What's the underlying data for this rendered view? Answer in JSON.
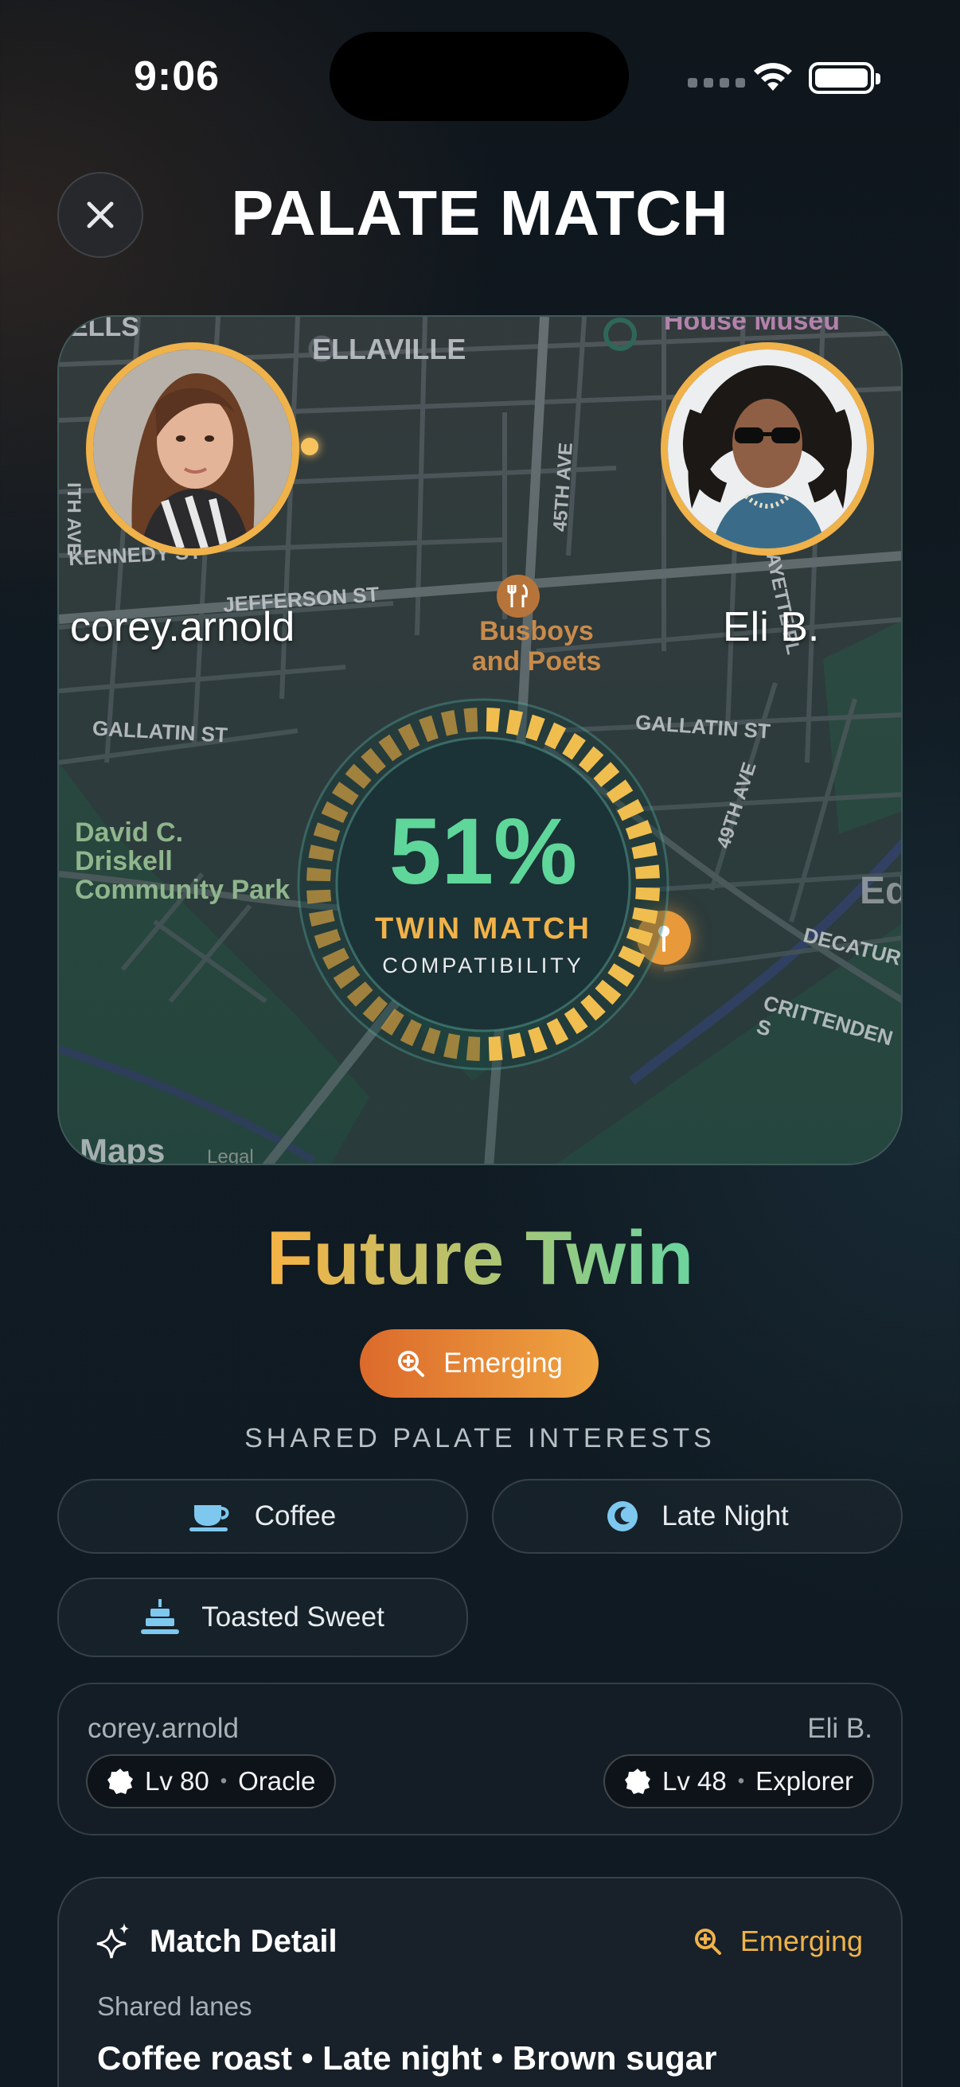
{
  "status_bar": {
    "time": "9:06"
  },
  "header": {
    "title": "PALATE MATCH"
  },
  "map": {
    "labels": {
      "ellaville": "ELLAVILLE",
      "ells": "ELLS",
      "house_museum": "House Museu",
      "kennedy": "KENNEDY ST",
      "jefferson": "JEFFERSON ST",
      "gallatin_left": "GALLATIN ST",
      "gallatin_right": "GALLATIN ST",
      "ave45": "45TH AVE",
      "ave49": "49TH AVE",
      "ave_left": "ITH AVE",
      "fayette": "FAYETTE PL",
      "decatur": "DECATUR",
      "crittenden": "CRITTENDEN S",
      "ed": "Ed"
    },
    "poi_name_line1": "Busboys",
    "poi_name_line2": "and Poets",
    "park_line1": "David C.",
    "park_line2": "Driskell",
    "park_line3": "Community Park",
    "maps_brand": "Maps",
    "legal": "Legal"
  },
  "users": {
    "left": {
      "name": "corey.arnold"
    },
    "right": {
      "name": "Eli B."
    }
  },
  "gauge": {
    "percent": "51%",
    "percent_value": 51,
    "label": "TWIN MATCH",
    "sublabel": "COMPATIBILITY"
  },
  "tier": {
    "title": "Future Twin",
    "badge": "Emerging"
  },
  "interests": {
    "section_label": "SHARED PALATE INTERESTS",
    "items": [
      {
        "label": "Coffee",
        "icon": "coffee-cup-icon"
      },
      {
        "label": "Late Night",
        "icon": "moon-icon"
      },
      {
        "label": "Toasted Sweet",
        "icon": "cake-icon"
      }
    ]
  },
  "levels": {
    "left": {
      "name": "corey.arnold",
      "level": "Lv 80",
      "rank": "Oracle"
    },
    "right": {
      "name": "Eli B.",
      "level": "Lv 48",
      "rank": "Explorer"
    }
  },
  "detail": {
    "title": "Match Detail",
    "tier": "Emerging",
    "sublabel": "Shared lanes",
    "value": "Coffee roast • Late night • Brown sugar"
  },
  "colors": {
    "accent_gold": "#f0b24a",
    "accent_green": "#5fd69a",
    "badge_orange": "#dc6a2b"
  }
}
